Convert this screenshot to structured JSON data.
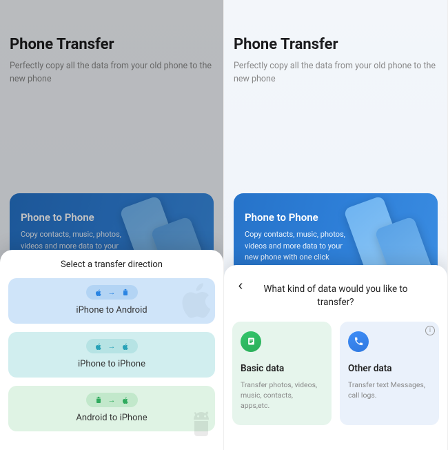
{
  "left": {
    "header": {
      "title": "Phone Transfer",
      "subtitle": "Perfectly copy all the data from your old phone to the new phone"
    },
    "promo": {
      "title": "Phone to Phone",
      "desc": "Copy contacts, music, photos, videos and more data to your new phone"
    },
    "sheet": {
      "title": "Select a transfer direction",
      "options": [
        {
          "label": "iPhone to Android",
          "from": "apple",
          "to": "android"
        },
        {
          "label": "iPhone to iPhone",
          "from": "apple",
          "to": "apple"
        },
        {
          "label": "Android to iPhone",
          "from": "android",
          "to": "apple"
        }
      ]
    }
  },
  "right": {
    "header": {
      "title": "Phone Transfer",
      "subtitle": "Perfectly copy all the data from your old phone to the new phone"
    },
    "promo": {
      "title": "Phone to Phone",
      "desc": "Copy contacts, music, photos, videos and more data to your new phone with one click"
    },
    "sheet": {
      "question": "What kind of data would you like to transfer?",
      "cards": [
        {
          "title": "Basic data",
          "desc": "Transfer photos, videos, music, contacts, apps,etc."
        },
        {
          "title": "Other data",
          "desc": "Transfer text Messages, call logs."
        }
      ]
    }
  }
}
